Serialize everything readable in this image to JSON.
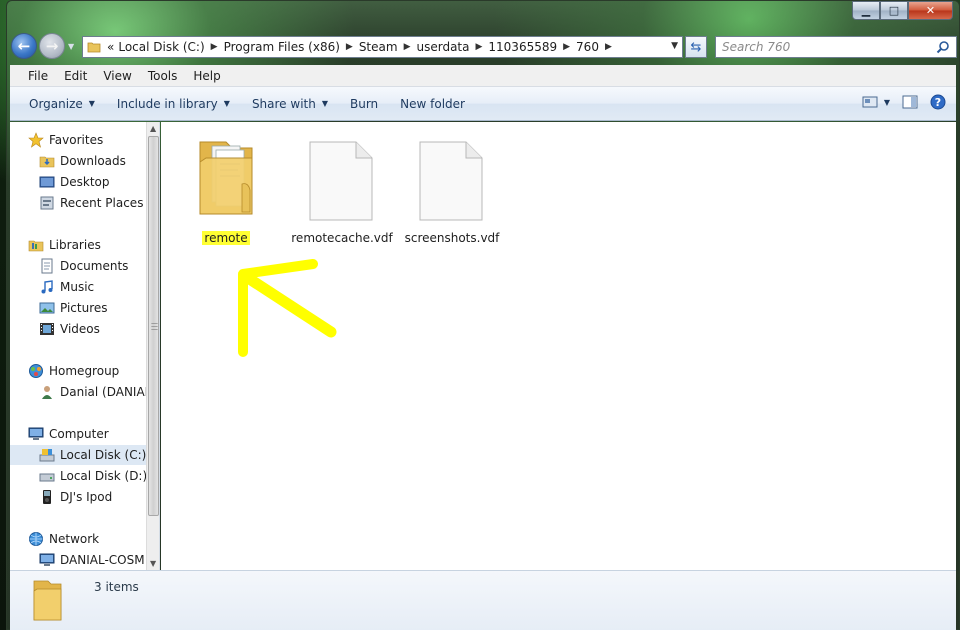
{
  "address": {
    "overflow_marker": "«",
    "crumbs": [
      "Local Disk (C:)",
      "Program Files (x86)",
      "Steam",
      "userdata",
      "110365589",
      "760"
    ]
  },
  "search": {
    "placeholder": "Search 760"
  },
  "menu": [
    "File",
    "Edit",
    "View",
    "Tools",
    "Help"
  ],
  "commands": {
    "organize": "Organize",
    "include_in_library": "Include in library",
    "share_with": "Share with",
    "burn": "Burn",
    "new_folder": "New folder"
  },
  "nav": {
    "favorites": "Favorites",
    "downloads": "Downloads",
    "desktop": "Desktop",
    "recent_places": "Recent Places",
    "libraries": "Libraries",
    "documents": "Documents",
    "music": "Music",
    "pictures": "Pictures",
    "videos": "Videos",
    "homegroup": "Homegroup",
    "homegroup_user": "Danial (DANIAL",
    "computer": "Computer",
    "local_disk_c": "Local Disk (C:)",
    "local_disk_d": "Local Disk (D:)",
    "ipod": "DJ's Ipod",
    "network": "Network",
    "network_pc": "DANIAL-COSM"
  },
  "files": [
    {
      "name": "remote",
      "type": "folder",
      "highlight_color": "#ffff33"
    },
    {
      "name": "remotecache.vdf",
      "type": "file"
    },
    {
      "name": "screenshots.vdf",
      "type": "file"
    }
  ],
  "status": {
    "item_count": "3 items"
  },
  "colors": {
    "annotation_arrow": "#ffff00",
    "selection": "#dde8f4"
  }
}
